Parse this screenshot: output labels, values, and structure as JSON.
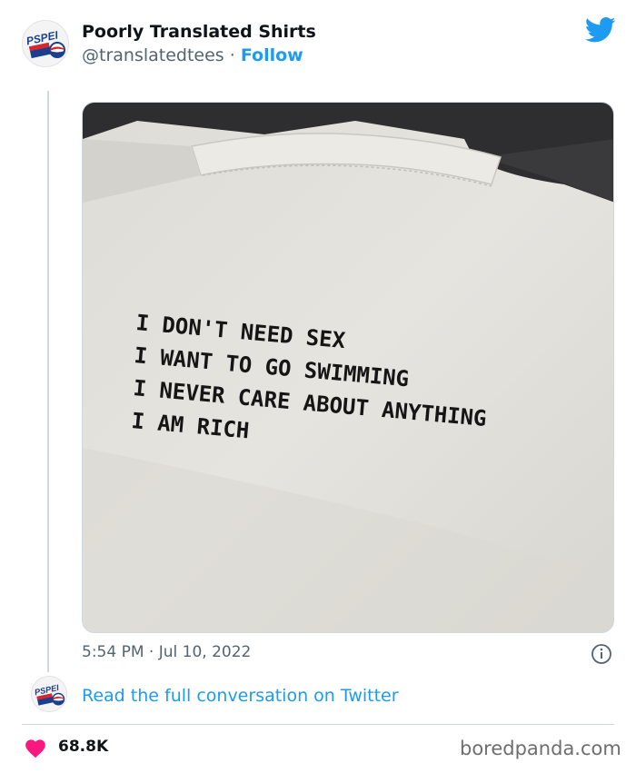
{
  "tweet": {
    "display_name": "Poorly Translated Shirts",
    "handle": "@translatedtees",
    "separator": "·",
    "follow_label": "Follow",
    "timestamp": "5:54 PM · Jul 10, 2022",
    "read_more_label": "Read the full conversation on Twitter",
    "likes": "68.8K",
    "icons": {
      "platform": "twitter-bird-icon",
      "info": "info-icon",
      "like": "heart-icon",
      "avatar": "pspei-logo-avatar"
    },
    "avatar_logo_text": "PSPEI",
    "image": {
      "shirt_text_lines": [
        "I DON'T NEED SEX",
        "I WANT TO GO SWIMMING",
        "I NEVER CARE ABOUT ANYTHING",
        "I AM RICH"
      ]
    }
  },
  "footer": {
    "watermark": "boredpanda.com"
  },
  "colors": {
    "link": "#1d9bf0",
    "heart": "#f91880",
    "muted": "#536471",
    "divider": "#cfd9de"
  }
}
